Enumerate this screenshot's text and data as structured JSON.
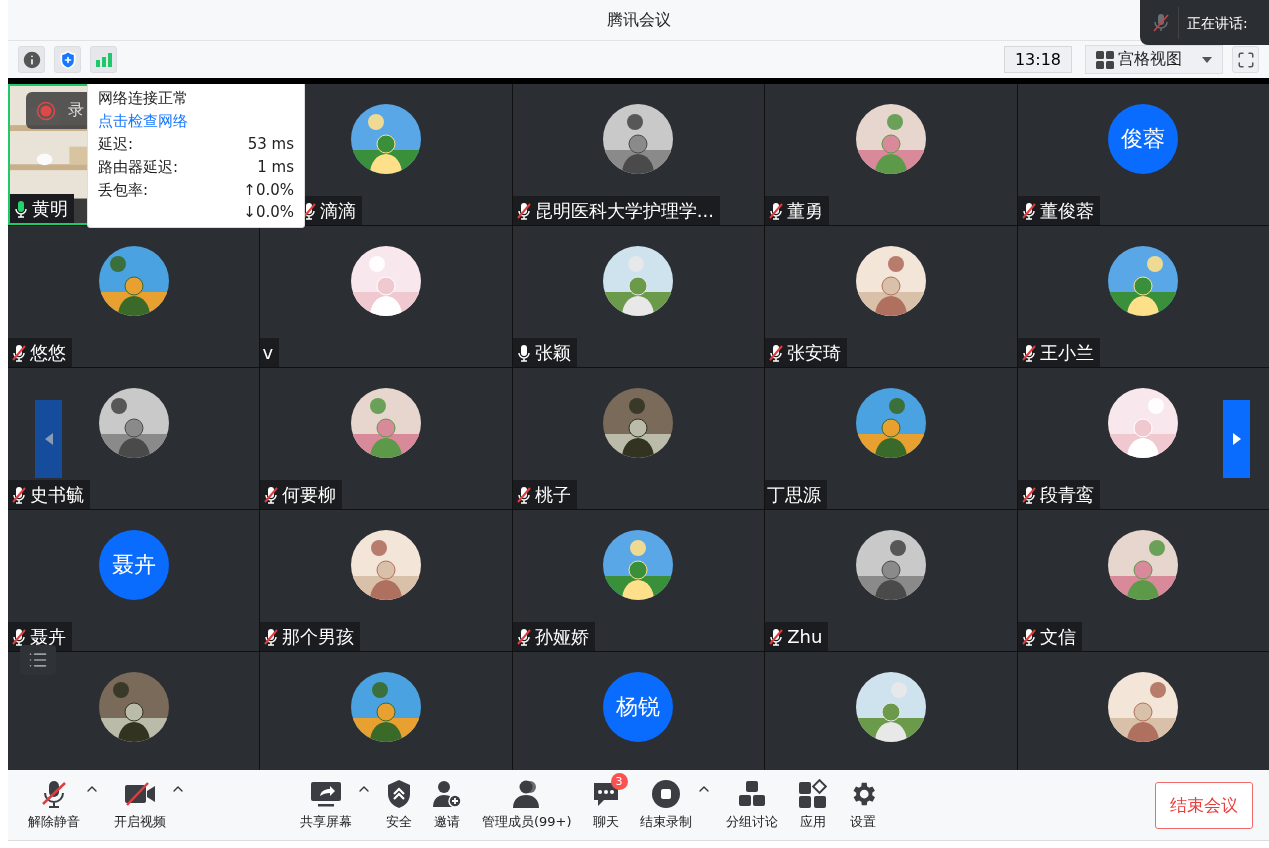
{
  "window": {
    "title": "腾讯会议"
  },
  "speaking": {
    "label": "正在讲话:"
  },
  "top_bar": {
    "time": "13:18",
    "view": "宫格视图"
  },
  "network_popup": {
    "status": "网络连接正常",
    "link": "点击检查网络",
    "rows": [
      {
        "label": "延迟:",
        "values": [
          "53 ms"
        ]
      },
      {
        "label": "路由器延迟:",
        "values": [
          "1 ms"
        ]
      },
      {
        "label": "丢包率:",
        "values": [
          "↑0.0%",
          "↓0.0%"
        ]
      }
    ]
  },
  "recording_badge": {
    "label": "录"
  },
  "tiles": [
    {
      "kind": "video",
      "name": "黄明",
      "muted": false,
      "speaking": true
    },
    {
      "kind": "picture",
      "name": "滴滴",
      "muted": true,
      "speaking": false
    },
    {
      "kind": "picture",
      "name": "昆明医科大学护理学...",
      "muted": true,
      "speaking": false
    },
    {
      "kind": "picture",
      "name": "董勇",
      "muted": true,
      "speaking": false
    },
    {
      "kind": "initials",
      "initials": "俊蓉",
      "name": "董俊蓉",
      "muted": true,
      "speaking": false
    },
    {
      "kind": "picture",
      "name": "悠悠",
      "muted": true,
      "speaking": false
    },
    {
      "kind": "picture",
      "name": "v"
    },
    {
      "kind": "picture",
      "name": "张颖",
      "muted": false,
      "speaking": false
    },
    {
      "kind": "picture",
      "name": "张安琦",
      "muted": true,
      "speaking": false
    },
    {
      "kind": "picture",
      "name": "王小兰",
      "muted": true,
      "speaking": false
    },
    {
      "kind": "picture",
      "name": "史书毓",
      "muted": true,
      "speaking": false
    },
    {
      "kind": "picture",
      "name": "何要柳",
      "muted": true,
      "speaking": false
    },
    {
      "kind": "picture",
      "name": "桃子",
      "muted": true,
      "speaking": false
    },
    {
      "kind": "picture",
      "name": "丁思源"
    },
    {
      "kind": "picture",
      "name": "段青鸾",
      "muted": true,
      "speaking": false
    },
    {
      "kind": "initials",
      "initials": "聂卉",
      "name": "聂卉",
      "muted": true,
      "speaking": false
    },
    {
      "kind": "picture",
      "name": "那个男孩",
      "muted": true,
      "speaking": false
    },
    {
      "kind": "picture",
      "name": "孙娅娇",
      "muted": true,
      "speaking": false
    },
    {
      "kind": "picture",
      "name": "Zhu",
      "muted": true,
      "speaking": false
    },
    {
      "kind": "picture",
      "name": "文信",
      "muted": true,
      "speaking": false
    },
    {
      "kind": "picture"
    },
    {
      "kind": "picture"
    },
    {
      "kind": "initials",
      "initials": "杨锐"
    },
    {
      "kind": "picture"
    },
    {
      "kind": "picture"
    }
  ],
  "toolbar": {
    "items": [
      {
        "kind": "mic",
        "label": "解除静音",
        "caret": true
      },
      {
        "kind": "video",
        "label": "开启视频",
        "caret": true
      },
      {
        "kind": "share",
        "label": "共享屏幕",
        "caret": true
      },
      {
        "kind": "security",
        "label": "安全",
        "caret": false
      },
      {
        "kind": "invite",
        "label": "邀请",
        "caret": false
      },
      {
        "kind": "members",
        "label": "管理成员(99+)",
        "caret": false
      },
      {
        "kind": "chat",
        "label": "聊天",
        "caret": false,
        "badge": "3"
      },
      {
        "kind": "record",
        "label": "结束录制",
        "caret": true
      },
      {
        "kind": "breakout",
        "label": "分组讨论",
        "caret": false
      },
      {
        "kind": "apps",
        "label": "应用",
        "caret": false
      },
      {
        "kind": "settings",
        "label": "设置",
        "caret": false
      }
    ],
    "end_button": "结束会议"
  }
}
